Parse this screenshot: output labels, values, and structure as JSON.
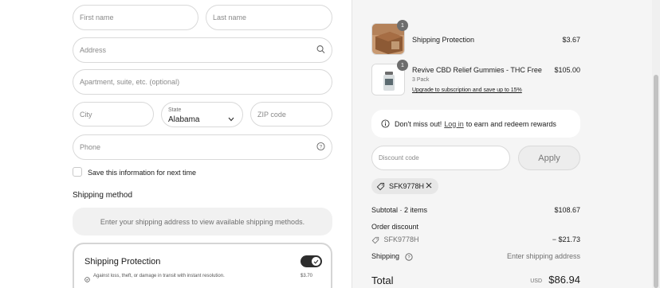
{
  "form": {
    "first_name_placeholder": "First name",
    "last_name_placeholder": "Last name",
    "address_placeholder": "Address",
    "apartment_placeholder": "Apartment, suite, etc. (optional)",
    "city_placeholder": "City",
    "state_label": "State",
    "state_value": "Alabama",
    "zip_placeholder": "ZIP code",
    "phone_placeholder": "Phone",
    "save_info_label": "Save this information for next time"
  },
  "shipping_method": {
    "title": "Shipping method",
    "notice": "Enter your shipping address to view available shipping methods."
  },
  "shipping_protection_card": {
    "title": "Shipping Protection",
    "description": "Against loss, theft, or damage in transit with instant resolution.",
    "price": "$3.70",
    "enabled": true
  },
  "order_summary": {
    "items": [
      {
        "qty": "1",
        "name": "Shipping Protection",
        "price": "$3.67",
        "variant": "",
        "link": "",
        "icon": "package-box-image"
      },
      {
        "qty": "1",
        "name": "Revive CBD Relief Gummies - THC Free",
        "price": "$105.00",
        "variant": "3 Pack",
        "link": "Upgrade to subscription and save up to 15%",
        "icon": "gummies-jar-image"
      }
    ],
    "rewards": {
      "pre": "Don't miss out!",
      "link": "Log in",
      "post": "to earn and redeem rewards"
    },
    "discount_placeholder": "Discount code",
    "apply_label": "Apply",
    "applied_code": "SFK9778H",
    "subtotal_label": "Subtotal · 2 items",
    "subtotal_value": "$108.67",
    "order_discount_label": "Order discount",
    "discount_code_label": "SFK9778H",
    "discount_value": "− $21.73",
    "shipping_label": "Shipping",
    "shipping_value": "Enter shipping address",
    "total_label": "Total",
    "currency": "USD",
    "total_value": "$86.94"
  },
  "colors": {
    "accent_dark": "#2d2d2d",
    "summary_bg": "#f5f5f5"
  }
}
